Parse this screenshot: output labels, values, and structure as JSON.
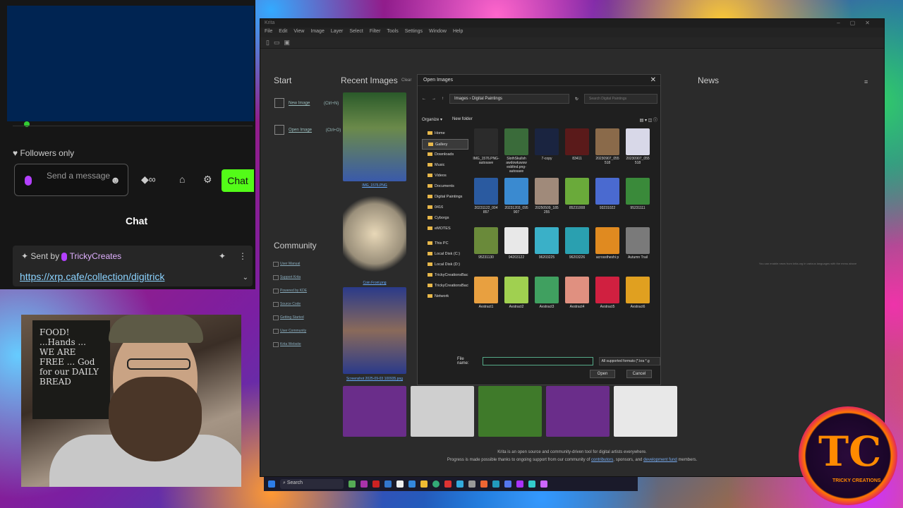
{
  "krita": {
    "window_title": "Krita",
    "menu": [
      "File",
      "Edit",
      "View",
      "Image",
      "Layer",
      "Select",
      "Filter",
      "Tools",
      "Settings",
      "Window",
      "Help"
    ],
    "start_heading": "Start",
    "new_image": "New Image",
    "new_image_shortcut": "(Ctrl+N)",
    "open_image": "Open Image",
    "open_image_shortcut": "(Ctrl+O)",
    "recent_heading": "Recent Images",
    "clear_label": "Clear",
    "community_heading": "Community",
    "community_links": [
      "User Manual",
      "Support Krita",
      "Powered by KDE",
      "Source Code",
      "Getting Started",
      "User Community",
      "Krita Website"
    ],
    "recent_thumbs": [
      {
        "label": "IMG_1576.PNG",
        "color": "#4f6b3a"
      },
      {
        "label": "Coin Front.png",
        "color": "#9a8f7a"
      },
      {
        "label": "Screenshot 2025-09-03 100935.png",
        "color": "#3a4b7a"
      }
    ],
    "bottom_thumbs": [
      "#6a2d8a",
      "#cfcfcf",
      "#3f7a2a",
      "#6a2d8a",
      "#e8e8e8"
    ],
    "news_heading": "News",
    "news_note": "You can enable news from krita.org in various languages with the menu above",
    "news_note_link": "enable news",
    "footer_line1": "Krita is an open source and community-driven tool for digital artists everywhere.",
    "footer_line2_a": "Progress is made possible thanks to ongoing support from our community of",
    "footer_contributors": "contributors",
    "footer_sponsors": ", sponsors, and",
    "footer_devfund": "development fund",
    "footer_members": "members."
  },
  "dialog": {
    "title": "Open Images",
    "path": "Images › Digital Paintings",
    "search_placeholder": "Search Digital Paintings",
    "organize": "Organize ▾",
    "new_folder": "New folder",
    "nav": [
      "Home",
      "Gallery",
      "Downloads",
      "Music",
      "Videos",
      "Documents",
      "Digital Paintings",
      "0416",
      "Cyborgs",
      "eMOTES",
      "This PC",
      "Local Disk (C:)",
      "Local Disk (D:)",
      "TrickyCreationsBac",
      "TrickyCreationsBack",
      "Network"
    ],
    "files": [
      {
        "name": "IMG_1576.PNG-autosave",
        "color": "#2b2b2b"
      },
      {
        "name": "SlothSkullsh awdowtuwsw esbltnd.png-autosave",
        "color": "#3a6b3a"
      },
      {
        "name": "7-copy",
        "color": "#1a2440"
      },
      {
        "name": "83411",
        "color": "#5a1a1a"
      },
      {
        "name": "20230907_055 518",
        "color": "#8a6a4a"
      },
      {
        "name": "20230907_055 518",
        "color": "#d8d8e8"
      },
      {
        "name": "20231122_004 857",
        "color": "#2a5aa0"
      },
      {
        "name": "20231203_095 907",
        "color": "#3a8ad0"
      },
      {
        "name": "20250509_185 255",
        "color": "#a08a7a"
      },
      {
        "name": "85231008",
        "color": "#6aaa3a"
      },
      {
        "name": "93231022",
        "color": "#4a6ad0"
      },
      {
        "name": "95231111",
        "color": "#3a8a3a"
      },
      {
        "name": "95231130",
        "color": "#6a8a3a"
      },
      {
        "name": "94203122",
        "color": "#e8e8e8"
      },
      {
        "name": "96203225",
        "color": "#3ab0c8"
      },
      {
        "name": "96203226",
        "color": "#2aa0b0"
      },
      {
        "name": "acrosstheshi p",
        "color": "#e08a20"
      },
      {
        "name": "Autumn Trail",
        "color": "#7a7a7a"
      },
      {
        "name": "Avstract1",
        "color": "#e8a040"
      },
      {
        "name": "Avstract2",
        "color": "#a0d050"
      },
      {
        "name": "Avstract3",
        "color": "#40a060"
      },
      {
        "name": "Avstract4",
        "color": "#e09080"
      },
      {
        "name": "Avstract5",
        "color": "#d02040"
      },
      {
        "name": "Avstract6",
        "color": "#e0a020"
      }
    ],
    "file_name_label": "File name:",
    "file_type": "All supported formats (*.kra *.g",
    "open_button": "Open",
    "cancel_button": "Cancel"
  },
  "taskbar": {
    "search": "Search"
  },
  "stream": {
    "followers_only": "Followers only",
    "send_placeholder": "Send a message",
    "chat_button": "Chat",
    "chat_label": "Chat",
    "sent_by": "Sent by",
    "sender": "TrickyCreates",
    "pinned_link": "https://xrp.cafe/collection/digitrick",
    "poster_text": "FOOD! ...Hands ... WE ARE FREE ... God for our DAILY BREAD",
    "logo_text": "TC",
    "logo_caption": "TRICKY CREATIONS"
  }
}
